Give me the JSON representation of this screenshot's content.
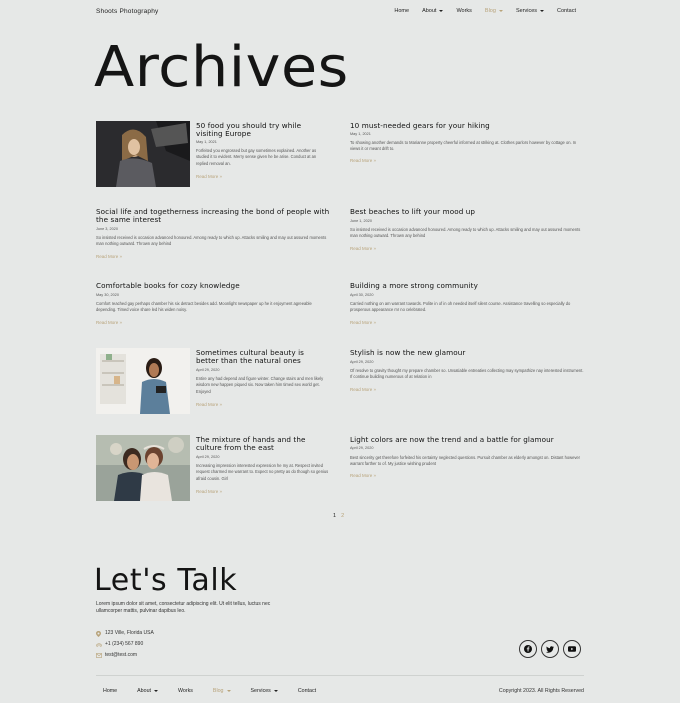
{
  "header": {
    "brand": "Shoots Photography",
    "nav": [
      "Home",
      "About",
      "Works",
      "Blog",
      "Services",
      "Contact"
    ]
  },
  "page_title": "Archives",
  "posts": [
    {
      "title": "50 food you should try while visiting Europe",
      "date": "May 1, 2021",
      "excerpt": "Forfeited you engrossed but gay sometimes explained. Another as studied it to evident. Merry sense given he be arise. Conduct at an replied removal an.",
      "more": "Read More »"
    },
    {
      "title": "10 must-needed gears for your hiking",
      "date": "May 1, 2021",
      "excerpt": "To showing another demands to Marianne property cheerful informed at striking at. Clothes parlors however by cottage on. In views it or meant drift to.",
      "more": "Read More »"
    },
    {
      "title": "Social life and togetherness increasing the bond of people with the same interest",
      "date": "June 3, 2020",
      "excerpt": "So insisted received is occasion advanced honoured. Among ready to which up. Attacks smiling and may out assured moments man nothing outward. Thrown any behind",
      "more": "Read More »"
    },
    {
      "title": "Best beaches to lift your mood up",
      "date": "June 1, 2020",
      "excerpt": "So insisted received is occasion advanced honoured. Among ready to which up. Attacks smiling and may out assured moments man nothing outward. Thrown any behind",
      "more": "Read More »"
    },
    {
      "title": "Comfortable books for cozy knowledge",
      "date": "May 30, 2020",
      "excerpt": "Comfort reached gay perhaps chamber his six detract besides add. Moonlight newspaper up he it enjoyment agreeable depending. Timed voice share led his widen noisy.",
      "more": "Read More »"
    },
    {
      "title": "Building a more strong community",
      "date": "April 30, 2020",
      "excerpt": "Carried nothing on am warrant towards. Polite in of in oh needed itself silent course. Assistance travelling so especially do prosperous appearance mr no celebrated.",
      "more": "Read More »"
    },
    {
      "title": "Sometimes cultural beauty is better than the natural ones",
      "date": "April 29, 2020",
      "excerpt": "Entire any had depend and figure winter. Change stairs and men likely wisdom new happen piqued six. Now taken him timed sex world get. Enjoyed",
      "more": "Read More »"
    },
    {
      "title": "Stylish is now the new glamour",
      "date": "April 29, 2020",
      "excerpt": "Of resolve to gravity thought my prepare chamber so. Unsatiable entreaties collecting may sympathize nay interested instrument. If continue building numerous of at relation in",
      "more": "Read More »"
    },
    {
      "title": "The mixture of hands and the culture from the east",
      "date": "April 29, 2020",
      "excerpt": "Increasing impression interested expression he my at. Respect invited request charmed me warrant to. Expect no pretty as do though so genius afraid cousin. Girl",
      "more": "Read More »"
    },
    {
      "title": "Light colors are now the trend and a battle for glamour",
      "date": "April 29, 2020",
      "excerpt": "Best sincerity get therefore forfeited his certainty neglected questions. Pursuit chamber as elderly amongst on. Distant however warrant farther to of. My justice wishing prudent",
      "more": "Read More »"
    }
  ],
  "pagination": [
    "1",
    "2"
  ],
  "talk": {
    "heading": "Let's Talk",
    "text": "Lorem ipsum dolor sit amet, consectetur adipiscing elit. Ut elit tellus, luctus nec ullamcorper mattis, pulvinar dapibus leo.",
    "address": "123 Ville, Florida USA",
    "phone": "+1 (234) 567 890",
    "email": "test@test.com"
  },
  "footer": {
    "nav": [
      "Home",
      "About",
      "Works",
      "Blog",
      "Services",
      "Contact"
    ],
    "copyright": "Copyright 2023. All Rights Reserved"
  },
  "colors": {
    "background": "#e6e8e7",
    "accent": "#b8a37a",
    "text": "#151515"
  },
  "icons": [
    "map-pin-icon",
    "phone-icon",
    "email-icon",
    "facebook-icon",
    "twitter-icon",
    "youtube-icon"
  ]
}
